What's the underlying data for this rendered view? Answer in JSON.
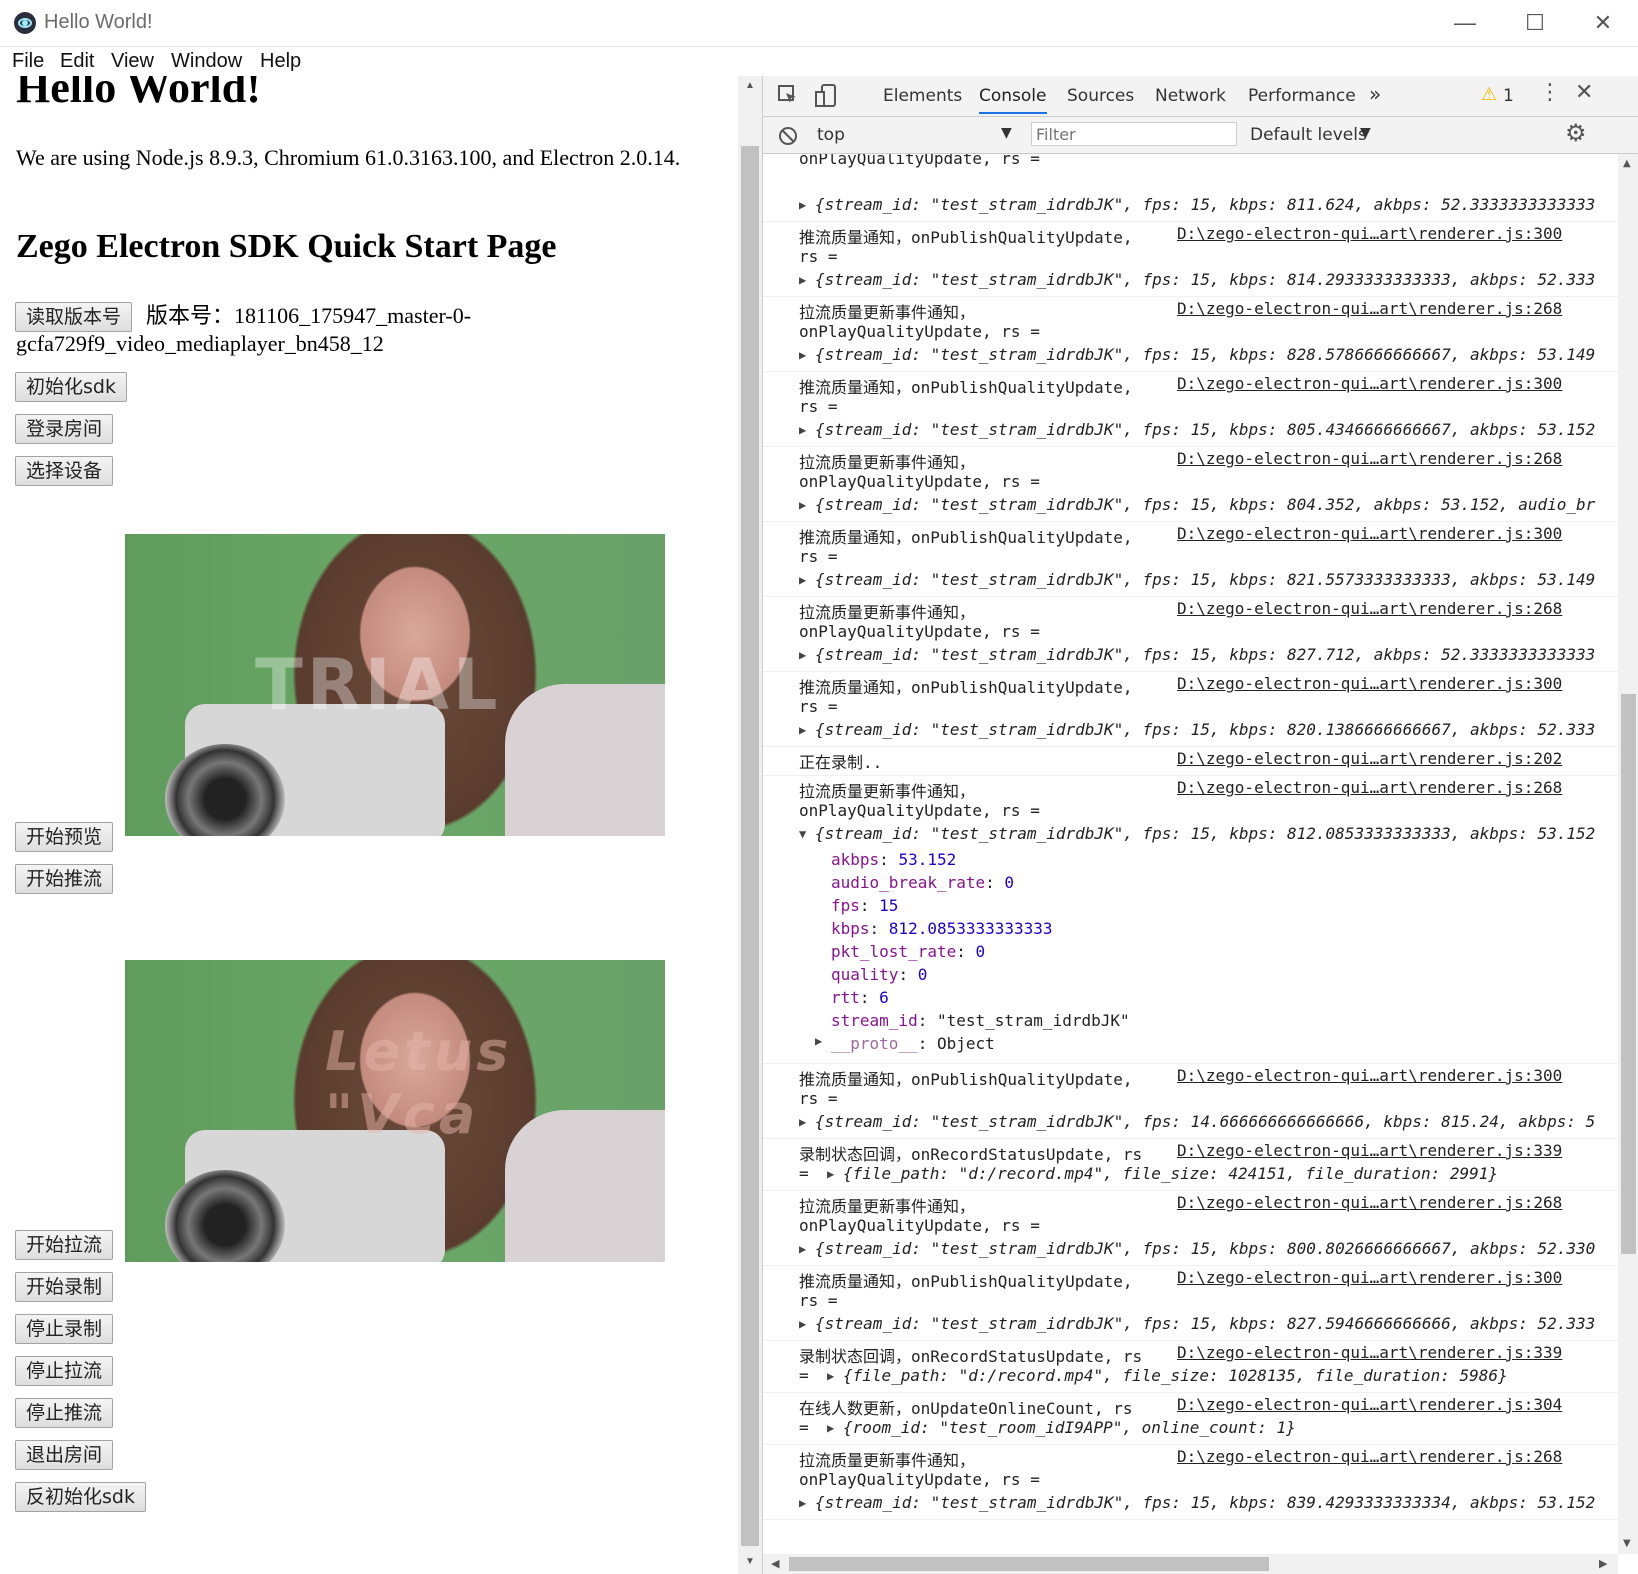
{
  "window": {
    "title": "Hello World!",
    "minimize": "—",
    "maximize": "☐",
    "close": "✕"
  },
  "menu": [
    "File",
    "Edit",
    "View",
    "Window",
    "Help"
  ],
  "page": {
    "h1": "Hello World!",
    "intro": "We are using Node.js 8.9.3, Chromium 61.0.3163.100, and Electron 2.0.14.",
    "h2": "Zego Electron SDK Quick Start Page",
    "version_button": "读取版本号",
    "version_text_1": "版本号：181106_175947_master-0-",
    "version_text_2": "gcfa729f9_video_mediaplayer_bn458_12",
    "buttons_top": [
      "初始化sdk",
      "登录房间",
      "选择设备"
    ],
    "buttons_mid": [
      "开始预览",
      "开始推流"
    ],
    "buttons_bottom": [
      "开始拉流",
      "开始录制",
      "停止录制",
      "停止拉流",
      "停止推流",
      "退出房间",
      "反初始化sdk"
    ],
    "video_watermark_1": "TRIAL",
    "video_watermark_2": "Letus \"Vca"
  },
  "devtools": {
    "tabs": [
      "Elements",
      "Console",
      "Sources",
      "Network",
      "Performance"
    ],
    "active_tab": "Console",
    "more": "»",
    "warning_count": "1",
    "context": "top",
    "filter_placeholder": "Filter",
    "levels": "Default levels",
    "messages": [
      {
        "l1": "onPlayQualityUpdate, rs =",
        "src": "",
        "l2": "{stream_id: \"test_stram_idrdbJK\", fps: 15, kbps: 811.624, akbps: 52.3333333333333"
      },
      {
        "l1": "推流质量通知，onPublishQualityUpdate,",
        "l1b": "rs =",
        "src": "D:\\zego-electron-qui…art\\renderer.js:300",
        "l2": "{stream_id: \"test_stram_idrdbJK\", fps: 15, kbps: 814.2933333333333, akbps: 52.333"
      },
      {
        "l1": "拉流质量更新事件通知，",
        "l1b": "onPlayQualityUpdate, rs =",
        "src": "D:\\zego-electron-qui…art\\renderer.js:268",
        "l2": "{stream_id: \"test_stram_idrdbJK\", fps: 15, kbps: 828.5786666666667, akbps: 53.149"
      },
      {
        "l1": "推流质量通知，onPublishQualityUpdate,",
        "l1b": "rs =",
        "src": "D:\\zego-electron-qui…art\\renderer.js:300",
        "l2": "{stream_id: \"test_stram_idrdbJK\", fps: 15, kbps: 805.4346666666667, akbps: 53.152"
      },
      {
        "l1": "拉流质量更新事件通知，",
        "l1b": "onPlayQualityUpdate, rs =",
        "src": "D:\\zego-electron-qui…art\\renderer.js:268",
        "l2": "{stream_id: \"test_stram_idrdbJK\", fps: 15, kbps: 804.352, akbps: 53.152, audio_br"
      },
      {
        "l1": "推流质量通知，onPublishQualityUpdate,",
        "l1b": "rs =",
        "src": "D:\\zego-electron-qui…art\\renderer.js:300",
        "l2": "{stream_id: \"test_stram_idrdbJK\", fps: 15, kbps: 821.5573333333333, akbps: 53.149"
      },
      {
        "l1": "拉流质量更新事件通知，",
        "l1b": "onPlayQualityUpdate, rs =",
        "src": "D:\\zego-electron-qui…art\\renderer.js:268",
        "l2": "{stream_id: \"test_stram_idrdbJK\", fps: 15, kbps: 827.712, akbps: 52.3333333333333"
      },
      {
        "l1": "推流质量通知，onPublishQualityUpdate,",
        "l1b": "rs =",
        "src": "D:\\zego-electron-qui…art\\renderer.js:300",
        "l2": "{stream_id: \"test_stram_idrdbJK\", fps: 15, kbps: 820.1386666666667, akbps: 52.333"
      },
      {
        "l1": "正在录制..",
        "src": "D:\\zego-electron-qui…art\\renderer.js:202"
      },
      {
        "l1": "拉流质量更新事件通知，",
        "l1b": "onPlayQualityUpdate, rs =",
        "src": "D:\\zego-electron-qui…art\\renderer.js:268",
        "l2": "{stream_id: \"test_stram_idrdbJK\", fps: 15, kbps: 812.0853333333333, akbps: 53.152"
      }
    ],
    "expanded": [
      {
        "key": "akbps",
        "val": "53.152"
      },
      {
        "key": "audio_break_rate",
        "val": "0"
      },
      {
        "key": "fps",
        "val": "15"
      },
      {
        "key": "kbps",
        "val": "812.0853333333333"
      },
      {
        "key": "pkt_lost_rate",
        "val": "0"
      },
      {
        "key": "quality",
        "val": "0"
      },
      {
        "key": "rtt",
        "val": "6"
      },
      {
        "key": "stream_id",
        "val": "\"test_stram_idrdbJK\""
      },
      {
        "key": "__proto__",
        "val": "Object"
      }
    ],
    "messages2": [
      {
        "l1": "推流质量通知，onPublishQualityUpdate,",
        "l1b": "rs =",
        "src": "D:\\zego-electron-qui…art\\renderer.js:300",
        "l2": "{stream_id: \"test_stram_idrdbJK\", fps: 14.666666666666666, kbps: 815.24, akbps: 5"
      },
      {
        "l1": "录制状态回调，onRecordStatusUpdate, rs",
        "l1b": "=",
        "src": "D:\\zego-electron-qui…art\\renderer.js:339",
        "l2": "{file_path: \"d:/record.mp4\", file_size: 424151, file_duration: 2991}",
        "inline": true
      },
      {
        "l1": "拉流质量更新事件通知，",
        "l1b": "onPlayQualityUpdate, rs =",
        "src": "D:\\zego-electron-qui…art\\renderer.js:268",
        "l2": "{stream_id: \"test_stram_idrdbJK\", fps: 15, kbps: 800.8026666666667, akbps: 52.330"
      },
      {
        "l1": "推流质量通知，onPublishQualityUpdate,",
        "l1b": "rs =",
        "src": "D:\\zego-electron-qui…art\\renderer.js:300",
        "l2": "{stream_id: \"test_stram_idrdbJK\", fps: 15, kbps: 827.5946666666666, akbps: 52.333"
      },
      {
        "l1": "录制状态回调，onRecordStatusUpdate, rs",
        "l1b": "=",
        "src": "D:\\zego-electron-qui…art\\renderer.js:339",
        "l2": "{file_path: \"d:/record.mp4\", file_size: 1028135, file_duration: 5986}",
        "inline": true
      },
      {
        "l1": "在线人数更新，onUpdateOnlineCount, rs",
        "l1b": "=",
        "src": "D:\\zego-electron-qui…art\\renderer.js:304",
        "l2": "{room_id: \"test_room_idI9APP\", online_count: 1}",
        "inline": true
      },
      {
        "l1": "拉流质量更新事件通知，",
        "l1b": "onPlayQualityUpdate, rs =",
        "src": "D:\\zego-electron-qui…art\\renderer.js:268",
        "l2": "{stream_id: \"test_stram_idrdbJK\", fps: 15, kbps: 839.4293333333334, akbps: 53.152"
      }
    ]
  }
}
